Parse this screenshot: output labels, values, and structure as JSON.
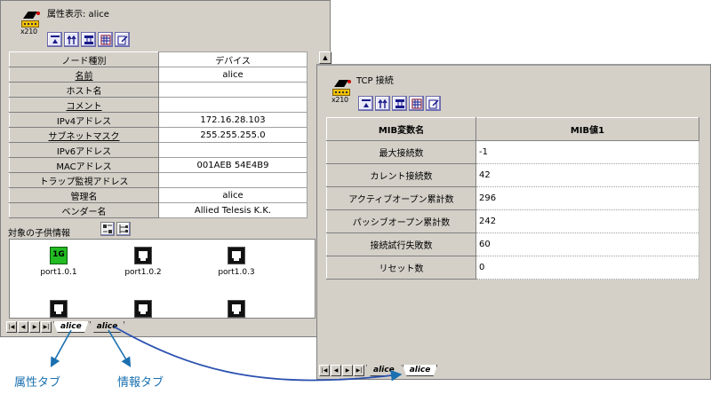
{
  "left_window": {
    "title": "属性表示: alice",
    "device_model": "x210",
    "properties": [
      {
        "key": "ノード種別",
        "value": "デバイス",
        "underline": false
      },
      {
        "key": "名前",
        "value": "alice",
        "underline": true
      },
      {
        "key": "ホスト名",
        "value": "",
        "underline": false
      },
      {
        "key": "コメント",
        "value": "",
        "underline": true
      },
      {
        "key": "IPv4アドレス",
        "value": "172.16.28.103",
        "underline": false
      },
      {
        "key": "サブネットマスク",
        "value": "255.255.255.0",
        "underline": true
      },
      {
        "key": "IPv6アドレス",
        "value": "",
        "underline": false
      },
      {
        "key": "MACアドレス",
        "value": "001AEB 54E4B9",
        "underline": false
      },
      {
        "key": "トラップ監視アドレス",
        "value": "",
        "underline": false
      },
      {
        "key": "管理名",
        "value": "alice",
        "underline": false
      },
      {
        "key": "ベンダー名",
        "value": "Allied Telesis K.K.",
        "underline": false
      }
    ],
    "children_label": "対象の子供情報",
    "ports": [
      {
        "name": "port1.0.1",
        "badge": "1G",
        "active": true
      },
      {
        "name": "port1.0.2",
        "badge": "",
        "active": false
      },
      {
        "name": "port1.0.3",
        "badge": "",
        "active": false
      }
    ],
    "tabs": [
      "alice",
      "alice"
    ]
  },
  "right_window": {
    "title": "TCP 接続",
    "device_model": "x210",
    "columns": [
      "MIB変数名",
      "MIB値1"
    ],
    "rows": [
      {
        "name": "最大接続数",
        "value": "-1"
      },
      {
        "name": "カレント接続数",
        "value": "42"
      },
      {
        "name": "アクティブオープン累計数",
        "value": "296"
      },
      {
        "name": "パッシブオープン累計数",
        "value": "242"
      },
      {
        "name": "接続試行失敗数",
        "value": "60"
      },
      {
        "name": "リセット数",
        "value": "0"
      }
    ],
    "tabs": [
      "alice",
      "alice"
    ]
  },
  "annotations": {
    "attr_tab": "属性タブ",
    "info_tab": "情報タブ"
  },
  "colors": {
    "window_bg": "#d4d0c8",
    "annotation": "#1a70b0",
    "active_port": "#22bb22"
  }
}
